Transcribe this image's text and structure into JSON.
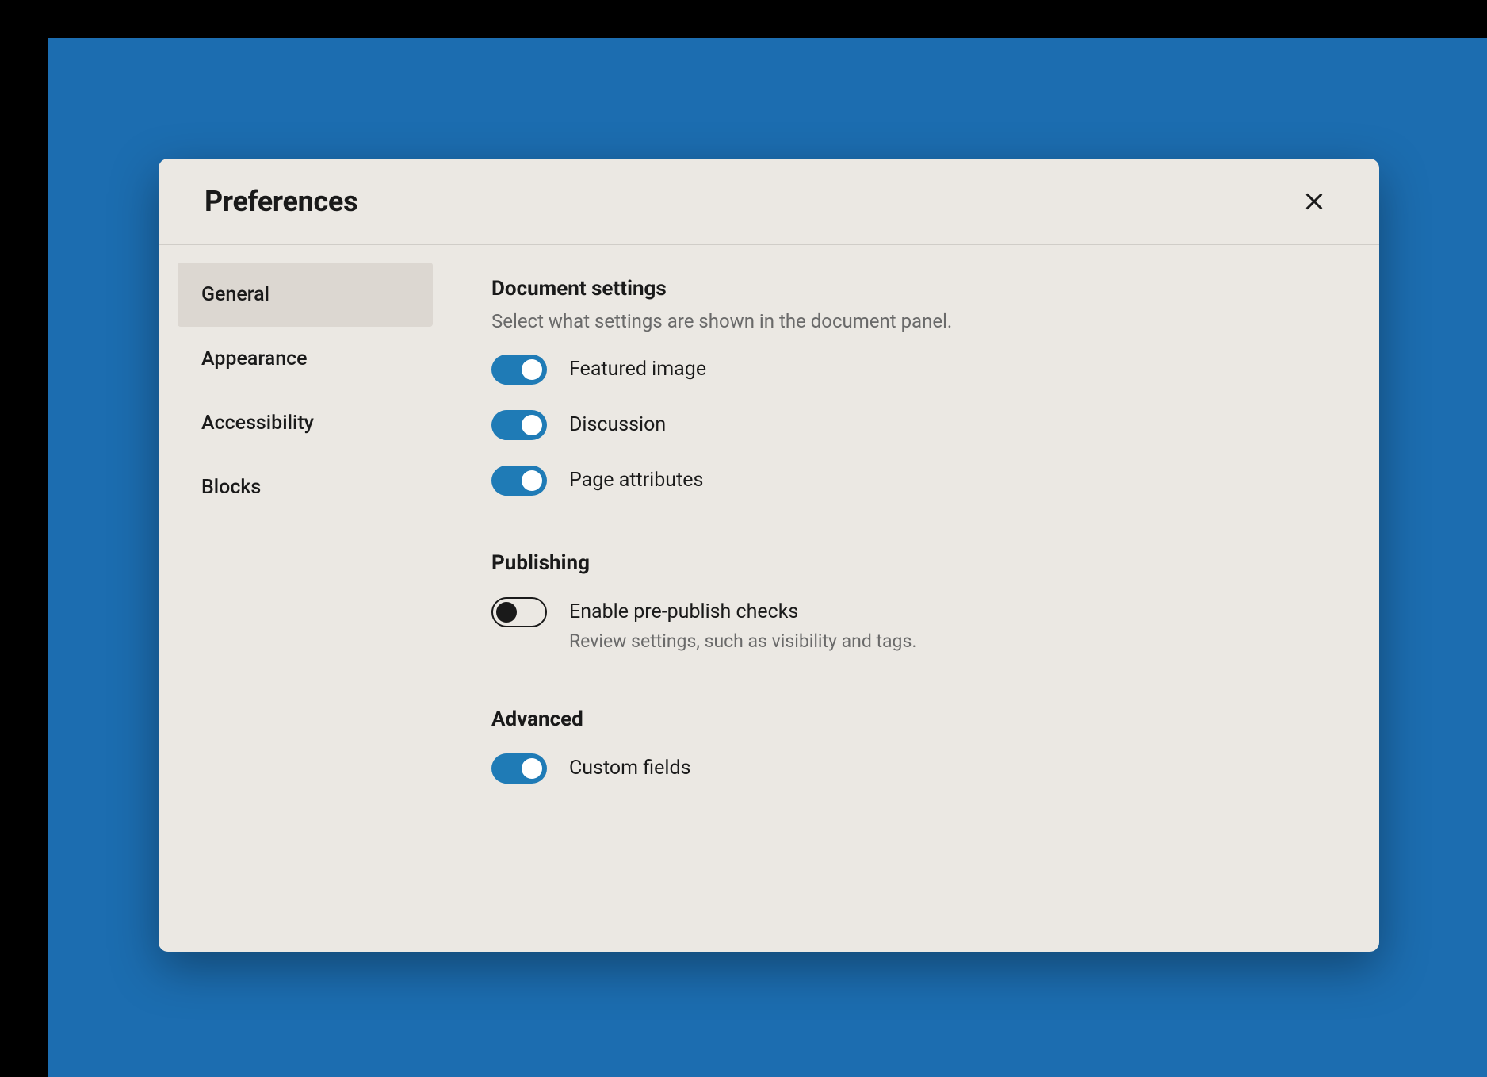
{
  "modal": {
    "title": "Preferences"
  },
  "tabs": [
    {
      "id": "general",
      "label": "General",
      "active": true
    },
    {
      "id": "appearance",
      "label": "Appearance",
      "active": false
    },
    {
      "id": "accessibility",
      "label": "Accessibility",
      "active": false
    },
    {
      "id": "blocks",
      "label": "Blocks",
      "active": false
    }
  ],
  "sections": {
    "document_settings": {
      "title": "Document settings",
      "description": "Select what settings are shown in the document panel.",
      "toggles": [
        {
          "id": "featured_image",
          "label": "Featured image",
          "on": true
        },
        {
          "id": "discussion",
          "label": "Discussion",
          "on": true
        },
        {
          "id": "page_attributes",
          "label": "Page attributes",
          "on": true
        }
      ]
    },
    "publishing": {
      "title": "Publishing",
      "toggles": [
        {
          "id": "pre_publish",
          "label": "Enable pre-publish checks",
          "sublabel": "Review settings, such as visibility and tags.",
          "on": false
        }
      ]
    },
    "advanced": {
      "title": "Advanced",
      "toggles": [
        {
          "id": "custom_fields",
          "label": "Custom fields",
          "on": true
        }
      ]
    }
  },
  "colors": {
    "backdrop": "#1c6db0",
    "modal_bg": "#ebe8e3",
    "tab_active_bg": "#dcd7d1",
    "toggle_on": "#1f7bb6",
    "text_primary": "#1a1a1a",
    "text_secondary": "#6a6a6a"
  }
}
